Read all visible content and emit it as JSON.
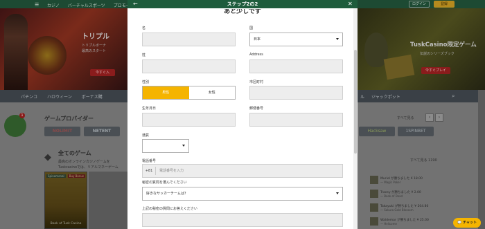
{
  "site": {
    "nav": [
      "カジノ",
      "バーチャルスポーツ",
      "プロモー"
    ],
    "login_label": "ログイン",
    "signup_label": "登録",
    "banner_left": {
      "title": "トリプル",
      "line1": "トリプルボーナ",
      "line2": "最高のスタート",
      "button": "今すぐ入"
    },
    "banner_right": {
      "title": "TuskCasino限定ゲーム",
      "line1": "伝説のシリーズブック",
      "button": "今すぐプレイ"
    },
    "categories_left": [
      "パチンコ",
      "ハロウィーン",
      "ボーナス購"
    ],
    "categories_right": [
      "ル",
      "ジャックポット"
    ],
    "providers_title": "ゲームプロバイダー",
    "providers_left": [
      "NOLIMIT",
      "NETENT"
    ],
    "providers_right": [
      "Hacksaw",
      "1SPINBET"
    ],
    "see_all": "すべて見る",
    "notification_count": "1",
    "all_games_title": "全てのゲーム",
    "all_games_desc_1": "最高のオンラインカジノゲームを",
    "all_games_desc_2": "Tuskcasinoでは、リアルマネーゲーム",
    "see_all_2": "すべて見る 1190",
    "tile": {
      "tag": "Spinomenal",
      "tag2": "Buy Bonus",
      "name": "Book of Tusk Casino"
    },
    "wins": [
      {
        "line1": "Muriel が勝ちました ¥ 18.00",
        "line2": "— Magic Poker"
      },
      {
        "line1": "Tracey が勝ちました ¥ 2.00",
        "line2": "— Book of Dead"
      },
      {
        "line1": "Takayuki が勝ちました ¥ 204.80",
        "line2": "— Sakura Gold Blossom"
      },
      {
        "line1": "Waldemar が勝ちました ¥ 25.00",
        "line2": "— Hellcome"
      }
    ],
    "chat_label": "チャット"
  },
  "modal": {
    "title": "ステップ2の2",
    "subtitle": "あと少しです",
    "first_name_label": "名",
    "country_label": "国",
    "country_value": "日本",
    "last_name_label": "姓",
    "address_label": "Address",
    "gender_label": "性別",
    "gender_male": "男性",
    "gender_female": "女性",
    "city_label": "市区町村",
    "dob_label": "生年月日",
    "postcode_label": "郵便番号",
    "currency_label": "通貨",
    "phone_label": "電話番号",
    "phone_code": "+81",
    "phone_placeholder": "電話番号を入力",
    "secret_q_label": "秘密の質問を選んでください",
    "secret_q_value": "好きなサッカーチームは？",
    "secret_a_label": "上記の秘密の質問にお答えください"
  },
  "colors": {
    "accent": "#f5b400",
    "header": "#1e5c3c"
  }
}
